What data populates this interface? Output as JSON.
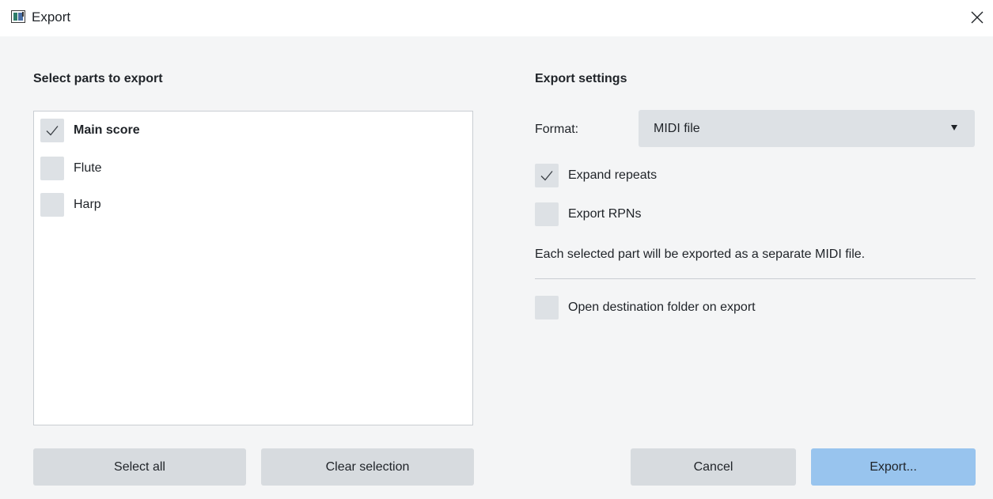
{
  "window": {
    "title": "Export",
    "app_icon": "app-icon",
    "close_icon": "close-icon"
  },
  "left_panel": {
    "heading": "Select parts to export",
    "parts": [
      {
        "label": "Main score",
        "checked": true
      },
      {
        "label": "Flute",
        "checked": false
      },
      {
        "label": "Harp",
        "checked": false
      }
    ],
    "select_all_label": "Select all",
    "clear_selection_label": "Clear selection"
  },
  "right_panel": {
    "heading": "Export settings",
    "format_label": "Format:",
    "format_value": "MIDI file",
    "expand_repeats": {
      "label": "Expand repeats",
      "checked": true
    },
    "export_rpns": {
      "label": "Export RPNs",
      "checked": false
    },
    "info": "Each selected part will be exported as a separate MIDI file.",
    "open_folder": {
      "label": "Open destination folder on export",
      "checked": false
    }
  },
  "footer": {
    "cancel_label": "Cancel",
    "export_label": "Export..."
  },
  "colors": {
    "primary_button": "#98c4ee",
    "control_fill": "#dde1e5",
    "background": "#f4f5f6"
  }
}
